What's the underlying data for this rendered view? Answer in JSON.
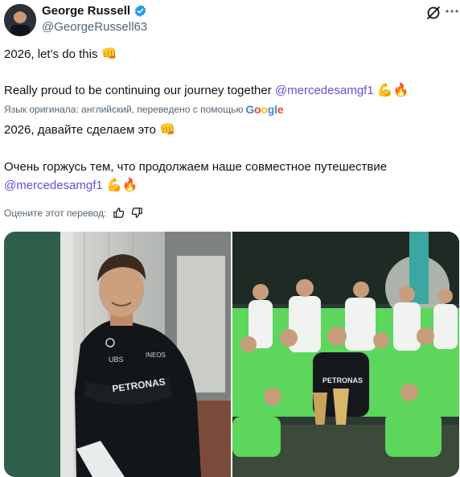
{
  "author": {
    "display_name": "George Russell",
    "handle": "@GeorgeRussell63"
  },
  "post": {
    "line1": "2026, let’s do this",
    "line1_emoji": "👊",
    "line2_prefix": "Really proud to be continuing our journey together ",
    "line2_mention": "@mercedesamgf1",
    "line2_emoji": "💪🔥"
  },
  "translation": {
    "note_prefix": "Язык оригинала: английский, переведено с помощью",
    "provider": "Google",
    "line1": "2026, давайте сделаем это",
    "line1_emoji": "👊",
    "line2": "Очень горжусь тем, что продолжаем наше совместное путешествие",
    "line3_mention": "@mercedesamgf1",
    "line3_emoji": "💪🔥",
    "rate_label": "Оцените этот перевод:"
  },
  "photos": {
    "left_shirt_text": "PETRONAS",
    "left_logo_text": "INEOS",
    "left_ubs_text": "UBS",
    "right_shirt_text": "PETRONAS"
  },
  "icons": {
    "verified": "verified-badge-icon",
    "grok": "grok-icon",
    "more": "more-icon",
    "thumb_up": "thumb-up-icon",
    "thumb_down": "thumb-down-icon"
  },
  "colors": {
    "link": "#1d9bf0",
    "mention_purple": "#6d4bd7",
    "muted": "#536471",
    "team_green": "#5cd65c"
  }
}
